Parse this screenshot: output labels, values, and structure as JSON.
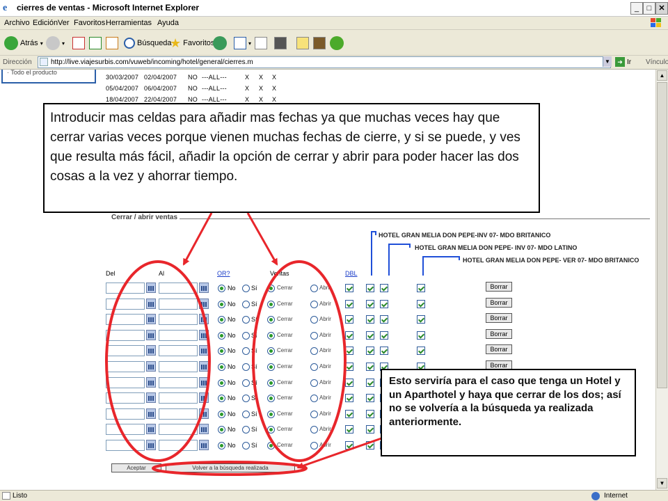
{
  "window": {
    "title": "cierres de ventas - Microsoft Internet Explorer"
  },
  "menu": [
    "Archivo",
    "Edición",
    "Ver",
    "Favoritos",
    "Herramientas",
    "Ayuda"
  ],
  "toolbar": {
    "back": "Atrás",
    "search": "Búsqueda",
    "favorites": "Favoritos"
  },
  "address": {
    "label": "Dirección",
    "url": "http://live.viajesurbis.com/vuweb/incoming/hotel/general/cierres.m",
    "go": "Ir",
    "links": "Vínculos"
  },
  "sidebar": {
    "item": "· Todo el producto"
  },
  "history": [
    {
      "from": "30/03/2007",
      "to": "02/04/2007",
      "or": "NO",
      "all": "---ALL---",
      "x1": "X",
      "x2": "X",
      "x3": "X"
    },
    {
      "from": "05/04/2007",
      "to": "06/04/2007",
      "or": "NO",
      "all": "---ALL---",
      "x1": "X",
      "x2": "X",
      "x3": "X"
    },
    {
      "from": "18/04/2007",
      "to": "22/04/2007",
      "or": "NO",
      "all": "---ALL---",
      "x1": "X",
      "x2": "X",
      "x3": "X"
    }
  ],
  "section": {
    "title": "Cerrar / abrir ventas"
  },
  "hotels": [
    "HOTEL GRAN MELIA DON PEPE-INV 07- MDO BRITANICO",
    "HOTEL GRAN MELIA DON PEPE- INV 07- MDO LATINO",
    "HOTEL GRAN MELIA DON PEPE- VER 07- MDO BRITANICO"
  ],
  "columns": {
    "del": "Del",
    "al": "Al",
    "or": "OR?",
    "ventas": "Ventas",
    "dbl": "DBL"
  },
  "row_labels": {
    "no": "No",
    "si": "Sí",
    "cerrar": "Cerrar",
    "abrir": "Abrir",
    "borrar": "Borrar"
  },
  "row_count": 11,
  "buttons": {
    "accept": "Aceptar",
    "back_to_search": "Volver a la búsqueda realizada"
  },
  "status": {
    "text": "Listo",
    "zone": "Internet"
  },
  "callouts": {
    "top": "Introducir mas celdas para añadir mas fechas ya que muchas veces hay que cerrar varias veces porque vienen muchas fechas de cierre, y si se puede, y ves que resulta más fácil, añadir la opción de cerrar y abrir para poder hacer las dos cosas a la vez y ahorrar tiempo.",
    "bottom": "Esto serviría para el caso que tenga un Hotel y un Aparthotel y haya que cerrar de los dos; así no se volvería a la búsqueda ya realizada anteriormente."
  },
  "colors": {
    "annotation_red": "#e8262b",
    "link_blue": "#1a3cc8",
    "bracket_blue": "#1f4fd8"
  }
}
